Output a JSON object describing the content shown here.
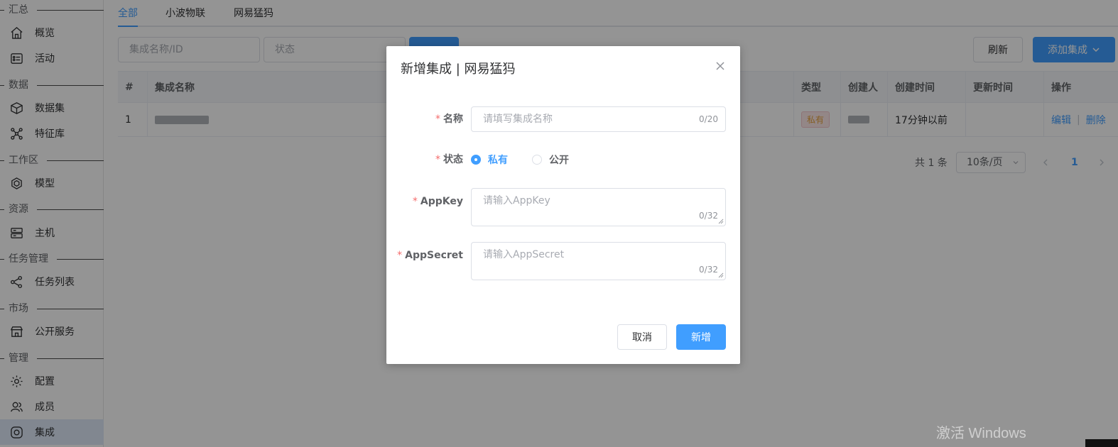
{
  "sidebar": {
    "groups": [
      {
        "title": "汇总",
        "items": [
          {
            "label": "概览",
            "icon": "home-icon"
          },
          {
            "label": "活动",
            "icon": "activity-icon"
          }
        ]
      },
      {
        "title": "数据",
        "items": [
          {
            "label": "数据集",
            "icon": "cube-icon"
          },
          {
            "label": "特征库",
            "icon": "feature-icon"
          }
        ]
      },
      {
        "title": "工作区",
        "items": [
          {
            "label": "模型",
            "icon": "model-icon"
          }
        ]
      },
      {
        "title": "资源",
        "items": [
          {
            "label": "主机",
            "icon": "server-icon"
          }
        ]
      },
      {
        "title": "任务管理",
        "items": [
          {
            "label": "任务列表",
            "icon": "task-icon"
          }
        ]
      },
      {
        "title": "市场",
        "items": [
          {
            "label": "公开服务",
            "icon": "store-icon"
          }
        ]
      },
      {
        "title": "管理",
        "items": [
          {
            "label": "配置",
            "icon": "gear-icon"
          },
          {
            "label": "成员",
            "icon": "users-icon"
          },
          {
            "label": "集成",
            "icon": "integration-icon",
            "active": true
          }
        ]
      }
    ]
  },
  "tabs": [
    "全部",
    "小波物联",
    "网易猛犸"
  ],
  "toolbar": {
    "name_placeholder": "集成名称/ID",
    "status_placeholder": "状态",
    "refresh_label": "刷新",
    "add_label": "添加集成"
  },
  "table": {
    "headers": {
      "index": "#",
      "name": "集成名称",
      "type": "类型",
      "creator": "创建人",
      "created": "创建时间",
      "updated": "更新时间",
      "actions": "操作"
    },
    "rows": [
      {
        "index": "1",
        "type": "私有",
        "created": "17分钟以前",
        "updated": "",
        "edit": "编辑",
        "delete": "删除"
      }
    ]
  },
  "pagination": {
    "total": "共 1 条",
    "page_size": "10条/页",
    "current": "1"
  },
  "dialog": {
    "title": "新增集成 | 网易猛犸",
    "name_label": "名称",
    "name_placeholder": "请填写集成名称",
    "name_count": "0/20",
    "status_label": "状态",
    "status_options": [
      "私有",
      "公开"
    ],
    "status_selected": "私有",
    "appkey_label": "AppKey",
    "appkey_placeholder": "请输入AppKey",
    "appkey_count": "0/32",
    "appsecret_label": "AppSecret",
    "appsecret_placeholder": "请输入AppSecret",
    "appsecret_count": "0/32",
    "cancel_label": "取消",
    "submit_label": "新增",
    "required_mark": "*"
  },
  "watermark": "激活 Windows",
  "colors": {
    "primary": "#409eff",
    "danger": "#f56c6c",
    "tag_private": "#e6a23c"
  }
}
